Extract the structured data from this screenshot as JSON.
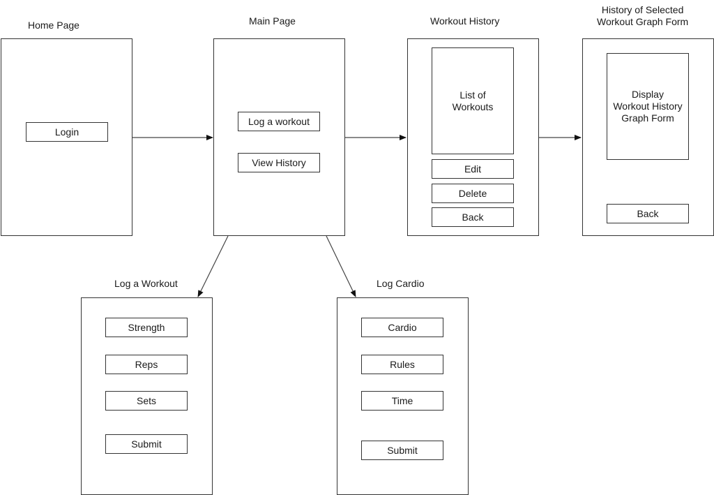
{
  "screens": {
    "home": {
      "title": "Home Page",
      "buttons": [
        "Login"
      ]
    },
    "main": {
      "title": "Main Page",
      "buttons": [
        "Log a workout",
        "View History"
      ]
    },
    "history": {
      "title": "Workout History",
      "panel_lines": [
        "List of",
        "Workouts"
      ],
      "buttons": [
        "Edit",
        "Delete",
        "Back"
      ]
    },
    "graph": {
      "title_lines": [
        "History of Selected",
        "Workout Graph Form"
      ],
      "panel_lines": [
        "Display",
        "Workout History",
        "Graph Form"
      ],
      "buttons": [
        "Back"
      ]
    },
    "log_workout": {
      "title": "Log a Workout",
      "buttons": [
        "Strength",
        "Reps",
        "Sets",
        "Submit"
      ]
    },
    "log_cardio": {
      "title": "Log Cardio",
      "buttons": [
        "Cardio",
        "Rules",
        "Time",
        "Submit"
      ]
    }
  },
  "connections": [
    {
      "from": "Home Page",
      "to": "Main Page"
    },
    {
      "from": "Main Page",
      "to": "Workout History"
    },
    {
      "from": "Workout History",
      "to": "History of Selected Workout Graph Form"
    },
    {
      "from": "Main Page",
      "to": "Log a Workout"
    },
    {
      "from": "Main Page",
      "to": "Log Cardio"
    }
  ],
  "colors": {
    "stroke": "#333333",
    "background": "#ffffff"
  }
}
